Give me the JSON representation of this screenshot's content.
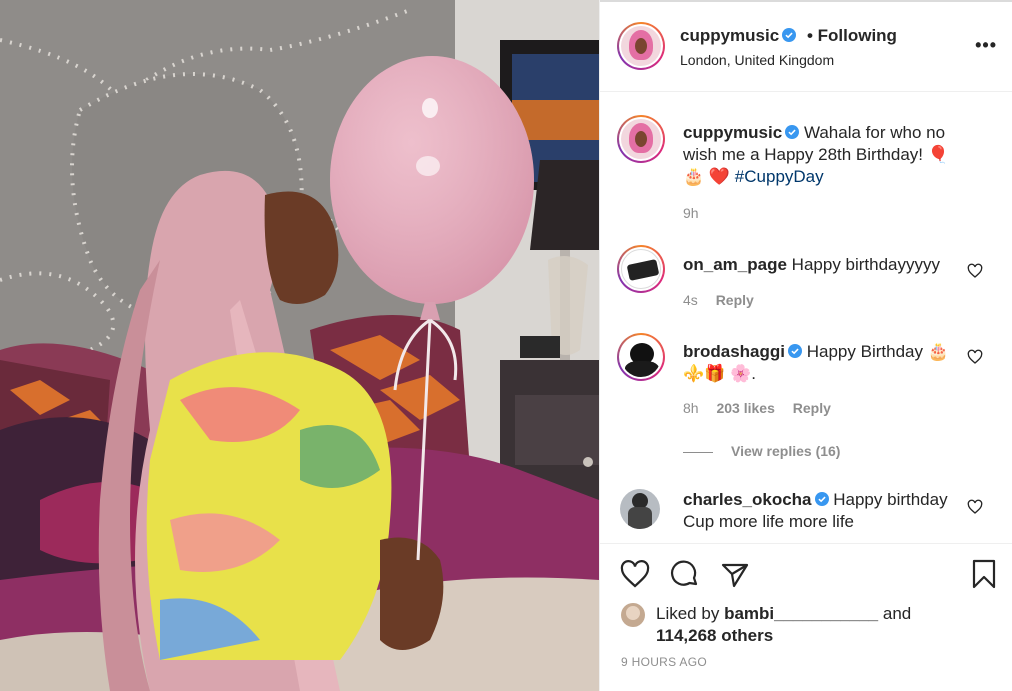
{
  "post": {
    "author": "cuppymusic",
    "follow_status": "Following",
    "separator": "•",
    "location": "London, United Kingdom",
    "more_icon": "more-options-icon"
  },
  "caption": {
    "user": "cuppymusic",
    "text": "Wahala for who no wish me a Happy 28th Birthday! 🎈🎂 ❤️",
    "hashtag": "#CuppyDay",
    "time": "9h"
  },
  "comments": [
    {
      "user": "on_am_page",
      "text": "Happy birthdayyyyy",
      "time": "4s",
      "likes": "",
      "reply": "Reply",
      "verified": false
    },
    {
      "user": "brodashaggi",
      "text": "Happy Birthday 🎂⚜️🎁 🌸.",
      "time": "8h",
      "likes": "203 likes",
      "reply": "Reply",
      "verified": true,
      "view_replies": "View replies (16)"
    },
    {
      "user": "charles_okocha",
      "text": "Happy birthday Cup more life more life",
      "time": "",
      "likes": "",
      "reply": "",
      "verified": true
    }
  ],
  "actions": {
    "liked_by_prefix": "Liked by",
    "liked_by_user": "bambi___________",
    "liked_by_and": "and",
    "likes_count": "114,268 others",
    "timestamp": "9 HOURS AGO",
    "icons": [
      "heart-icon",
      "comment-icon",
      "share-icon",
      "bookmark-icon"
    ]
  },
  "colors": {
    "link": "#00376b",
    "verified": "#3897f0",
    "muted": "#8e8e8e",
    "text": "#262626"
  }
}
